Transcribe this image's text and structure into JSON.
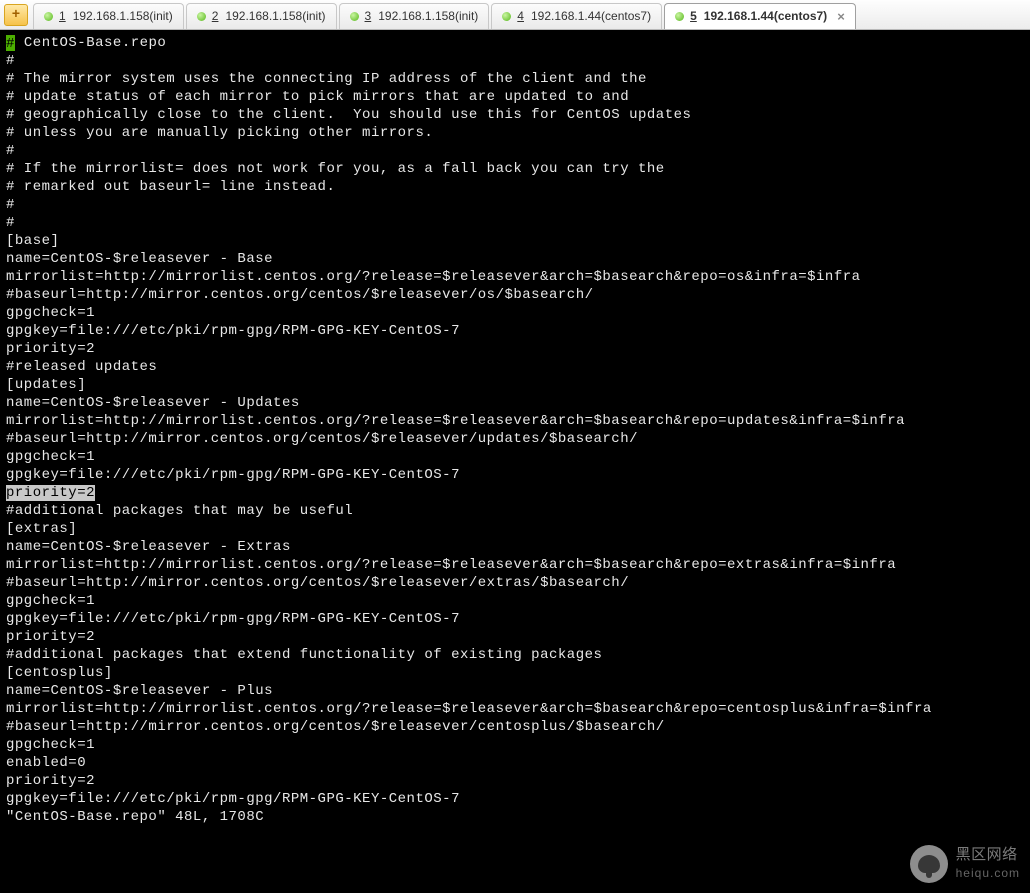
{
  "tabs": [
    {
      "num": "1",
      "label": "192.168.1.158(init)",
      "active": false
    },
    {
      "num": "2",
      "label": "192.168.1.158(init)",
      "active": false
    },
    {
      "num": "3",
      "label": "192.168.1.158(init)",
      "active": false
    },
    {
      "num": "4",
      "label": "192.168.1.44(centos7)",
      "active": false
    },
    {
      "num": "5",
      "label": "192.168.1.44(centos7)",
      "active": true
    }
  ],
  "add_tab_glyph": "+",
  "close_glyph": "×",
  "terminal_lines": [
    {
      "t": " CentOS-Base.repo",
      "cursor": true
    },
    {
      "t": "#"
    },
    {
      "t": "# The mirror system uses the connecting IP address of the client and the"
    },
    {
      "t": "# update status of each mirror to pick mirrors that are updated to and"
    },
    {
      "t": "# geographically close to the client.  You should use this for CentOS updates"
    },
    {
      "t": "# unless you are manually picking other mirrors."
    },
    {
      "t": "#"
    },
    {
      "t": "# If the mirrorlist= does not work for you, as a fall back you can try the"
    },
    {
      "t": "# remarked out baseurl= line instead."
    },
    {
      "t": "#"
    },
    {
      "t": "#"
    },
    {
      "t": ""
    },
    {
      "t": "[base]"
    },
    {
      "t": "name=CentOS-$releasever - Base"
    },
    {
      "t": "mirrorlist=http://mirrorlist.centos.org/?release=$releasever&arch=$basearch&repo=os&infra=$infra"
    },
    {
      "t": "#baseurl=http://mirror.centos.org/centos/$releasever/os/$basearch/"
    },
    {
      "t": "gpgcheck=1"
    },
    {
      "t": "gpgkey=file:///etc/pki/rpm-gpg/RPM-GPG-KEY-CentOS-7"
    },
    {
      "t": "priority=2"
    },
    {
      "t": ""
    },
    {
      "t": "#released updates"
    },
    {
      "t": "[updates]"
    },
    {
      "t": "name=CentOS-$releasever - Updates"
    },
    {
      "t": "mirrorlist=http://mirrorlist.centos.org/?release=$releasever&arch=$basearch&repo=updates&infra=$infra"
    },
    {
      "t": "#baseurl=http://mirror.centos.org/centos/$releasever/updates/$basearch/"
    },
    {
      "t": "gpgcheck=1"
    },
    {
      "t": "gpgkey=file:///etc/pki/rpm-gpg/RPM-GPG-KEY-CentOS-7"
    },
    {
      "t": "priority=2",
      "hl": true
    },
    {
      "t": ""
    },
    {
      "t": "#additional packages that may be useful"
    },
    {
      "t": "[extras]"
    },
    {
      "t": "name=CentOS-$releasever - Extras"
    },
    {
      "t": "mirrorlist=http://mirrorlist.centos.org/?release=$releasever&arch=$basearch&repo=extras&infra=$infra"
    },
    {
      "t": "#baseurl=http://mirror.centos.org/centos/$releasever/extras/$basearch/"
    },
    {
      "t": "gpgcheck=1"
    },
    {
      "t": "gpgkey=file:///etc/pki/rpm-gpg/RPM-GPG-KEY-CentOS-7"
    },
    {
      "t": "priority=2"
    },
    {
      "t": ""
    },
    {
      "t": "#additional packages that extend functionality of existing packages"
    },
    {
      "t": "[centosplus]"
    },
    {
      "t": "name=CentOS-$releasever - Plus"
    },
    {
      "t": "mirrorlist=http://mirrorlist.centos.org/?release=$releasever&arch=$basearch&repo=centosplus&infra=$infra"
    },
    {
      "t": "#baseurl=http://mirror.centos.org/centos/$releasever/centosplus/$basearch/"
    },
    {
      "t": "gpgcheck=1"
    },
    {
      "t": "enabled=0"
    },
    {
      "t": "priority=2"
    },
    {
      "t": "gpgkey=file:///etc/pki/rpm-gpg/RPM-GPG-KEY-CentOS-7"
    },
    {
      "t": "\"CentOS-Base.repo\" 48L, 1708C"
    }
  ],
  "watermark": {
    "title": "黑区网络",
    "sub": "heiqu.com"
  }
}
